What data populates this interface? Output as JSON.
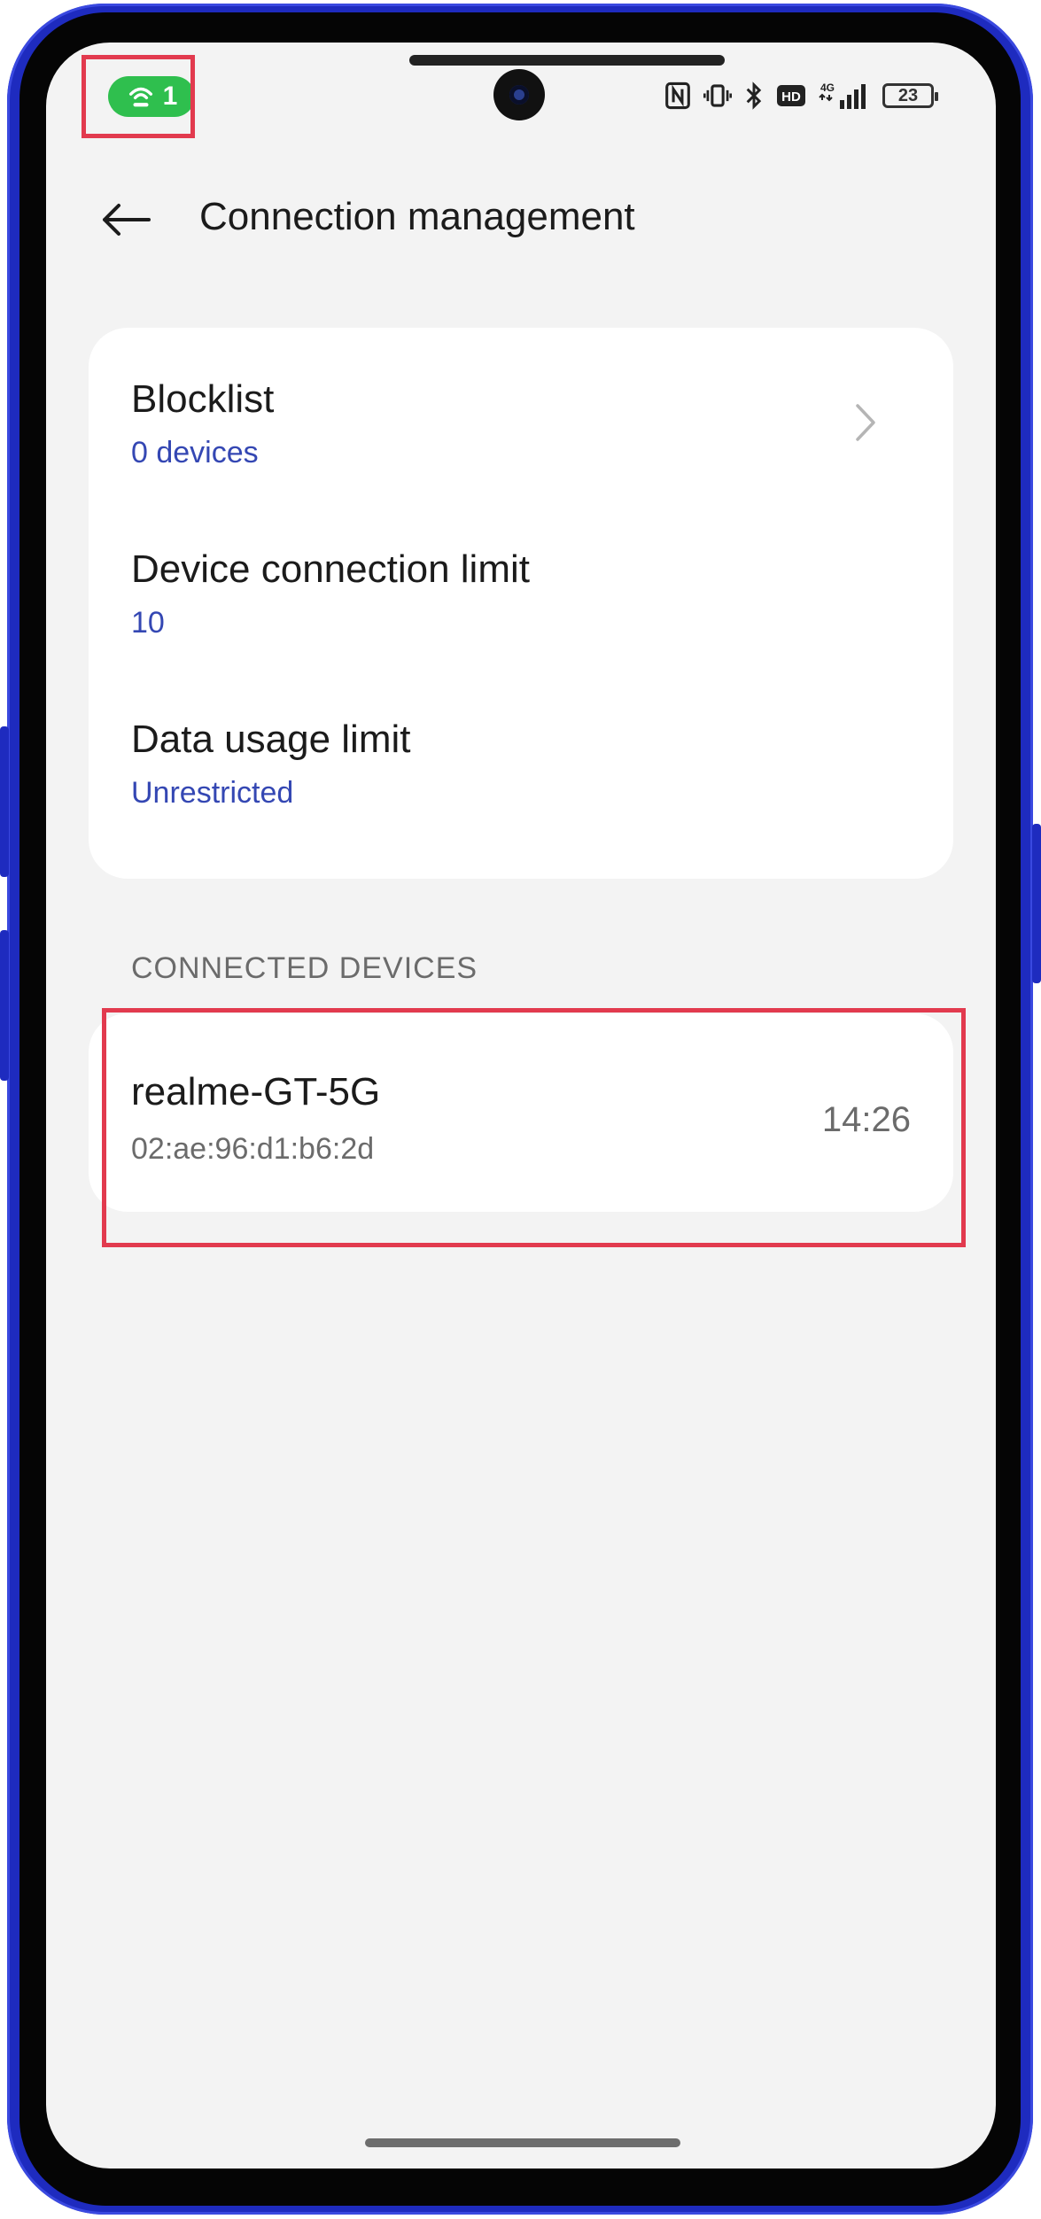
{
  "status_bar": {
    "hotspot_count": "1",
    "hotspot_icon": "hotspot-icon",
    "network_label": "4G",
    "hd_label": "HD",
    "battery_level": "23"
  },
  "header": {
    "back_icon": "back-arrow-icon",
    "title": "Connection management"
  },
  "settings": {
    "blocklist_title": "Blocklist",
    "blocklist_value": "0 devices",
    "connection_limit_title": "Device connection limit",
    "connection_limit_value": "10",
    "data_limit_title": "Data usage limit",
    "data_limit_value": "Unrestricted"
  },
  "connected_devices": {
    "section_label": "CONNECTED DEVICES",
    "items": [
      {
        "name": "realme-GT-5G",
        "mac": "02:ae:96:d1:b6:2d",
        "time": "14:26"
      }
    ]
  },
  "colors": {
    "accent_blue": "#3447b3",
    "hotspot_green": "#2fbf4e",
    "highlight_red": "#e23a4e",
    "frame_blue": "#1e2bbf"
  }
}
